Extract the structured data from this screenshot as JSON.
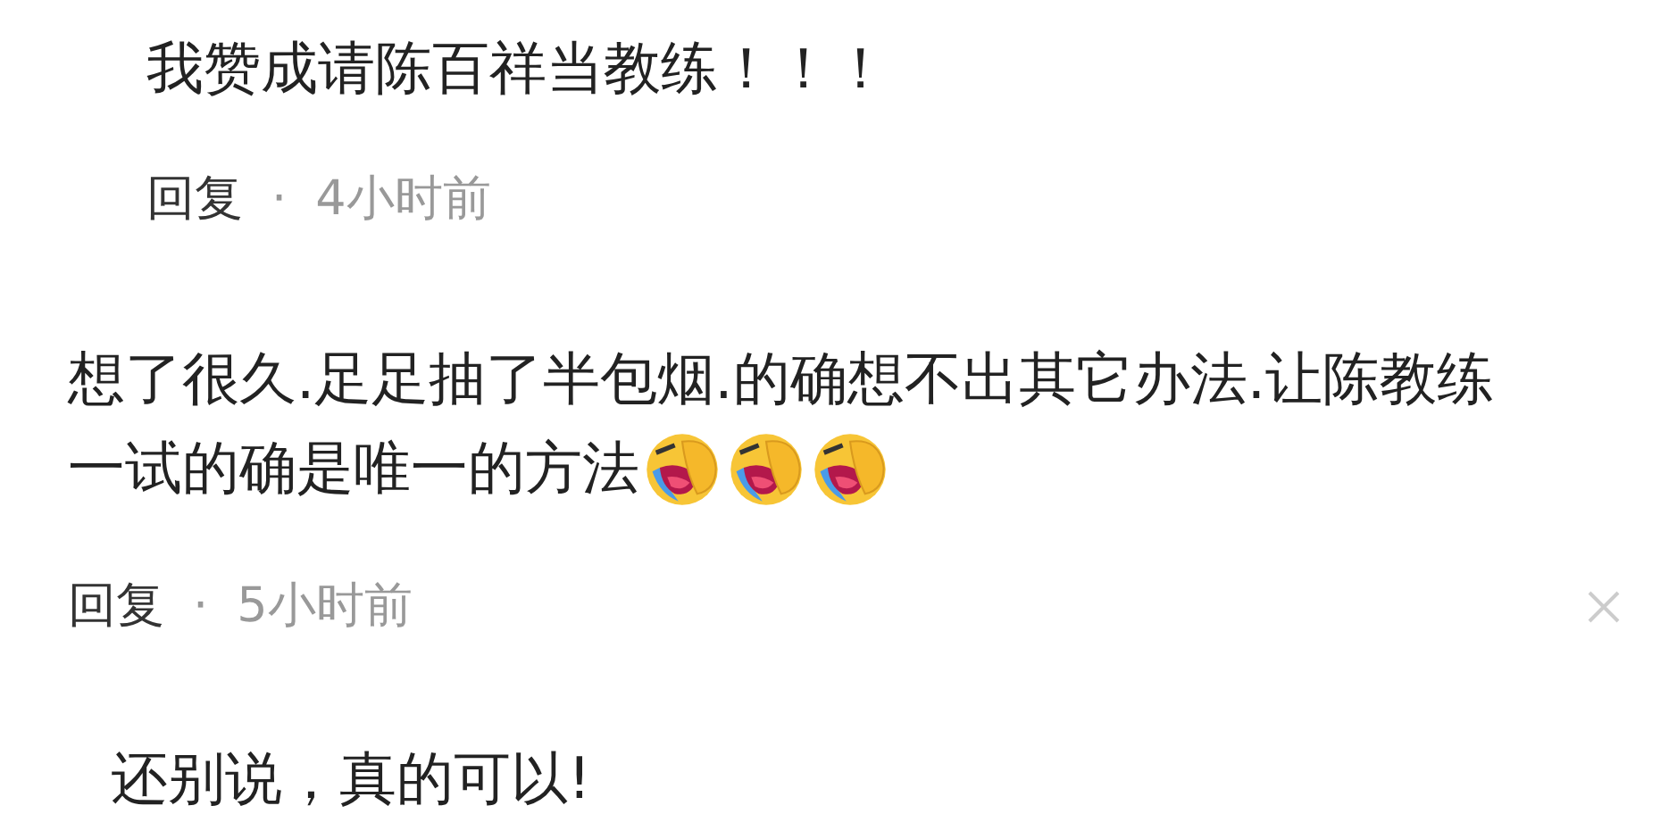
{
  "comments": [
    {
      "text": "我赞成请陈百祥当教练！！！",
      "indent": true,
      "reply": "回复",
      "separator": "·",
      "time": "4小时前",
      "close": false
    },
    {
      "text_lines": [
        "想了很久.足足抽了半包烟.的确想不出其它办法.让陈教练",
        "一试的确是唯一的方法"
      ],
      "indent": false,
      "reply": "回复",
      "separator": "·",
      "time": "5小时前",
      "close": true
    },
    {
      "text": "还别说，真的可以!",
      "indent": true
    }
  ]
}
